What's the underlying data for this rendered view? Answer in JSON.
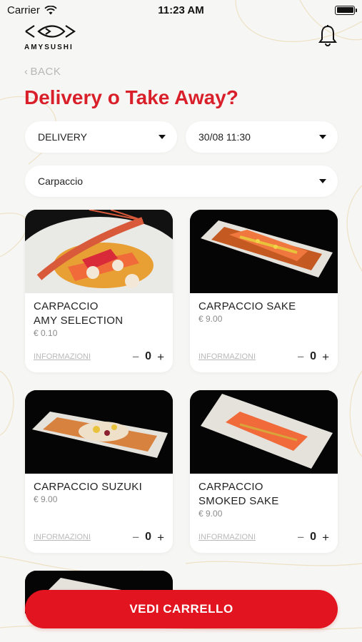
{
  "status_bar": {
    "carrier": "Carrier",
    "time": "11:23 AM",
    "battery_level": 1.0
  },
  "header": {
    "logo_text": "AMYSUSHI",
    "notification_icon": "bell-icon"
  },
  "nav": {
    "back_label": "BACK"
  },
  "page": {
    "title": "Delivery o Take Away?"
  },
  "filters": {
    "mode": "DELIVERY",
    "datetime": "30/08 11:30",
    "category": "Carpaccio"
  },
  "products": [
    {
      "name": "CARPACCIO\nAMY SELECTION",
      "price": "€ 0.10",
      "info_label": "INFORMAZIONI",
      "quantity": "0"
    },
    {
      "name": "CARPACCIO SAKE",
      "price": "€ 9.00",
      "info_label": "INFORMAZIONI",
      "quantity": "0"
    },
    {
      "name": "CARPACCIO SUZUKI",
      "price": "€ 9.00",
      "info_label": "INFORMAZIONI",
      "quantity": "0"
    },
    {
      "name": "CARPACCIO\nSMOKED SAKE",
      "price": "€ 9.00",
      "info_label": "INFORMAZIONI",
      "quantity": "0"
    }
  ],
  "stepper": {
    "minus": "−",
    "plus": "+"
  },
  "cart": {
    "label": "VEDI CARRELLO"
  },
  "colors": {
    "accent": "#e1141f",
    "title": "#d9202a",
    "background": "#f6f6f4"
  }
}
